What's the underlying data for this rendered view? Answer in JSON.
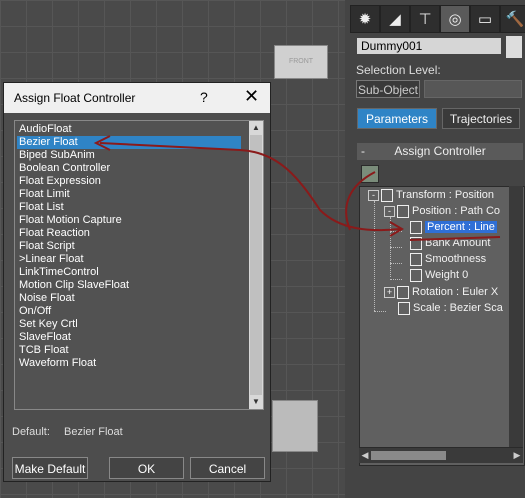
{
  "viewport": {
    "front_label": "FRONT"
  },
  "command_panel": {
    "tabs": [
      {
        "icon": "create-icon",
        "glyph": "✹"
      },
      {
        "icon": "modify-icon",
        "glyph": "◢"
      },
      {
        "icon": "hierarchy-icon",
        "glyph": "⊤"
      },
      {
        "icon": "motion-icon",
        "glyph": "◎"
      },
      {
        "icon": "display-icon",
        "glyph": "▭"
      },
      {
        "icon": "utilities-icon",
        "glyph": "🔨"
      }
    ],
    "object_name": "Dummy001",
    "selection_level_label": "Selection Level:",
    "sub_object": "Sub-Object",
    "parameters_tab": "Parameters",
    "trajectories_tab": "Trajectories",
    "rollout_title": "Assign Controller",
    "rollout_toggle": "-",
    "tree": [
      {
        "label": "Transform : Position",
        "expand": "-"
      },
      {
        "label": "Position : Path Co",
        "expand": "-"
      },
      {
        "label": "Percent : Line",
        "selected": true
      },
      {
        "label": "Bank Amount"
      },
      {
        "label": "Smoothness"
      },
      {
        "label": "Weight 0"
      },
      {
        "label": "Rotation : Euler X",
        "expand": "+"
      },
      {
        "label": "Scale : Bezier Sca"
      }
    ]
  },
  "dialog": {
    "title": "Assign Float Controller",
    "help": "?",
    "close": "✕",
    "items": [
      "AudioFloat",
      "Bezier Float",
      "Biped SubAnim",
      "Boolean Controller",
      "Float Expression",
      "Float Limit",
      "Float List",
      "Float Motion Capture",
      "Float Reaction",
      "Float Script",
      ">Linear Float",
      "LinkTimeControl",
      "Motion Clip SlaveFloat",
      "Noise Float",
      "On/Off",
      "Set Key Crtl",
      "SlaveFloat",
      "TCB Float",
      "Waveform Float"
    ],
    "selected_item": "Bezier Float",
    "default_label": "Default:",
    "default_value": "Bezier Float",
    "make_default": "Make Default",
    "ok": "OK",
    "cancel": "Cancel"
  }
}
